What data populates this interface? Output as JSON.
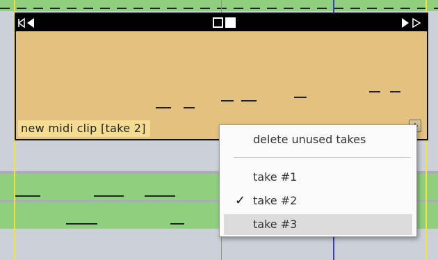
{
  "clip": {
    "name": "new midi clip [take 2]"
  },
  "context_menu": {
    "delete_label": "delete unused takes",
    "takes": [
      {
        "label": "take #1",
        "checked": false,
        "highlighted": false
      },
      {
        "label": "take #2",
        "checked": true,
        "highlighted": false
      },
      {
        "label": "take #3",
        "checked": false,
        "highlighted": true
      }
    ],
    "checkmark": "✓"
  },
  "colors": {
    "clip_body": "#e3c17e",
    "clip_label_bg": "#f5dc92",
    "track_green": "#8fd07e",
    "playhead": "#3b3fc0",
    "menu_highlight": "#dcdcdc"
  },
  "icons": {
    "header_left": "left-start-arrows-icon",
    "header_mid": "loop-marker-squares-icon",
    "header_right": "right-end-arrows-icon",
    "corner": "take-lane-toggle-icon"
  }
}
